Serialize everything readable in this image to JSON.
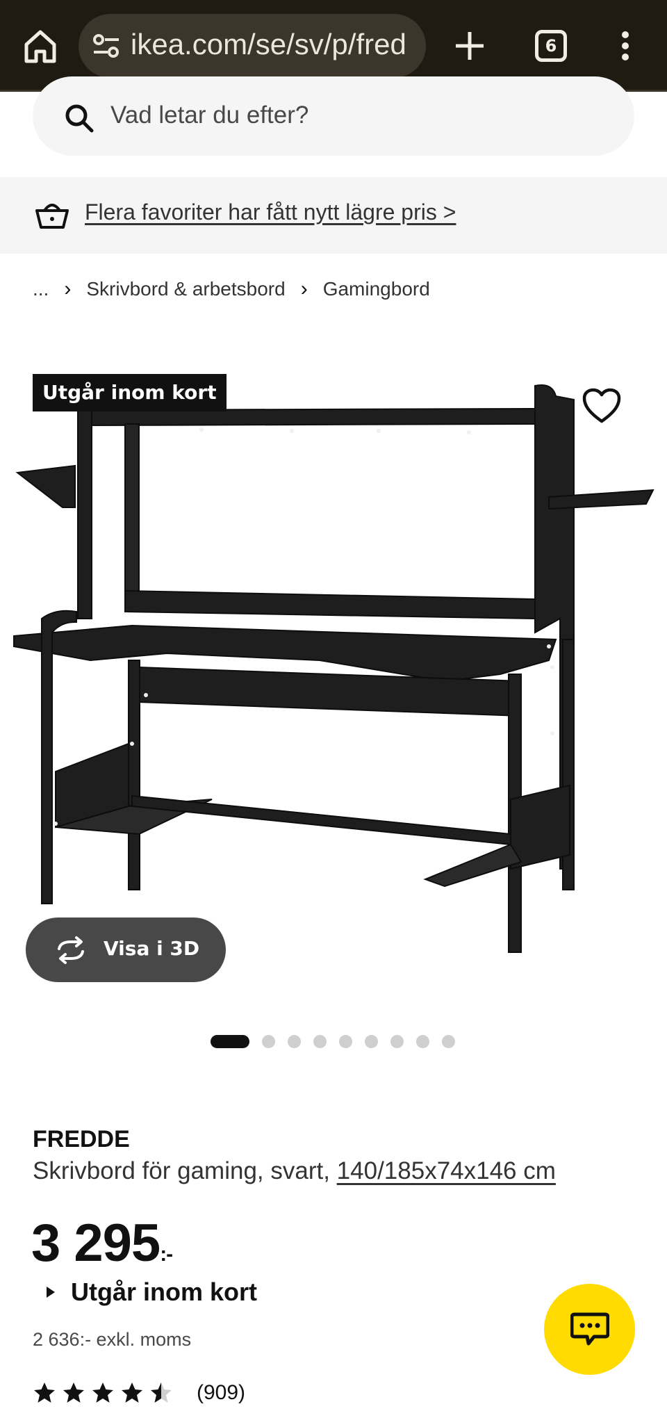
{
  "browser": {
    "url": "ikea.com/se/sv/p/fred",
    "tab_count": "6"
  },
  "search": {
    "placeholder": "Vad letar du efter?"
  },
  "promo": {
    "text": "Flera favoriter har fått nytt lägre pris >"
  },
  "breadcrumb": {
    "ellipsis": "...",
    "items": [
      "Skrivbord & arbetsbord",
      "Gamingbord"
    ]
  },
  "image": {
    "badge": "Utgår inom kort",
    "view3d_label": "Visa i 3D",
    "image_count": 9,
    "active_index": 0
  },
  "product": {
    "name": "FREDDE",
    "description": "Skrivbord för gaming, svart,",
    "dimensions": "140/185x74x146 cm",
    "price": "3 295",
    "price_suffix": ":-",
    "status": "Utgår inom kort",
    "price_ex_vat": "2 636:- exkl. moms",
    "rating_value": 4.5,
    "review_count": "(909)"
  },
  "colors": {
    "chrome_bg": "#1f1a12",
    "accent_yellow": "#ffdb00",
    "text": "#111111"
  },
  "icons": [
    "home-icon",
    "site-settings-icon",
    "plus-icon",
    "tabs-icon",
    "more-icon",
    "search-icon",
    "basket-icon",
    "heart-icon",
    "rotate-3d-icon",
    "star-icon",
    "chat-icon"
  ]
}
